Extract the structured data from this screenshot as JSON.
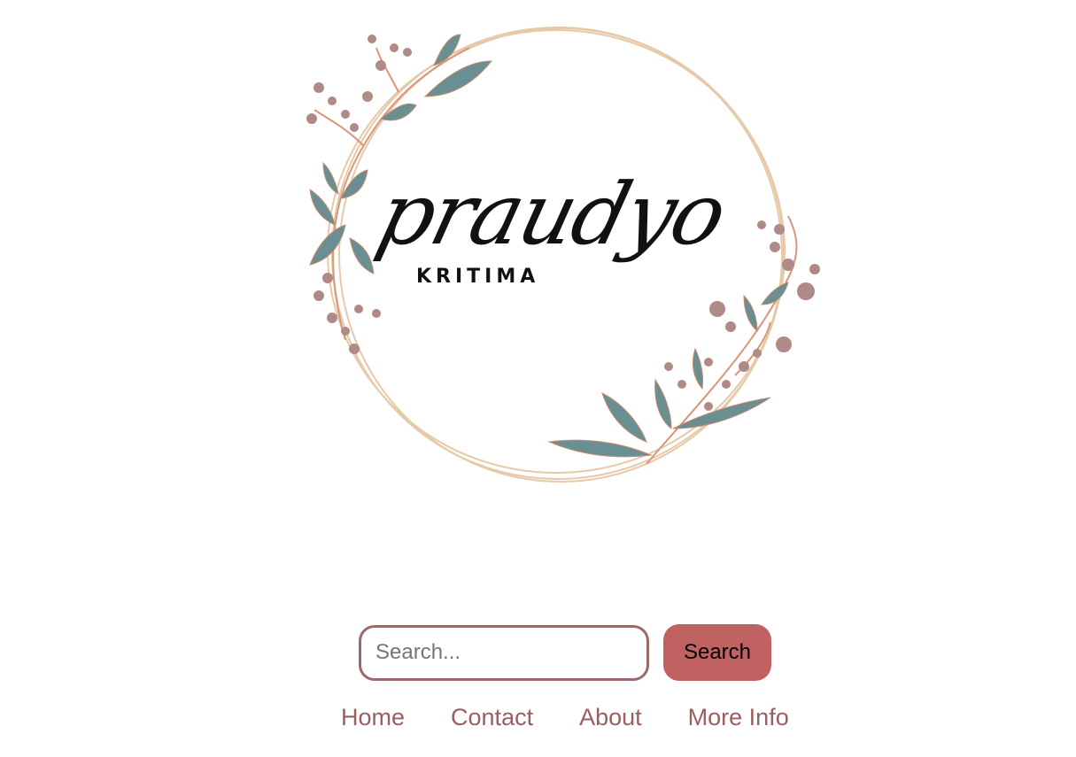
{
  "brand": {
    "script_text": "praudyo",
    "sub_text": "KRITIMA",
    "leaf_color": "#6a8f92",
    "flower_color": "#b08a86",
    "ring_color": "#e6c9a8"
  },
  "search": {
    "placeholder": "Search...",
    "value": "",
    "button_label": "Search",
    "border_color": "#9a6a6a",
    "button_color": "#c06262"
  },
  "nav": {
    "items": [
      {
        "label": "Home"
      },
      {
        "label": "Contact"
      },
      {
        "label": "About"
      },
      {
        "label": "More Info"
      }
    ],
    "link_color": "#9a5f5f"
  }
}
